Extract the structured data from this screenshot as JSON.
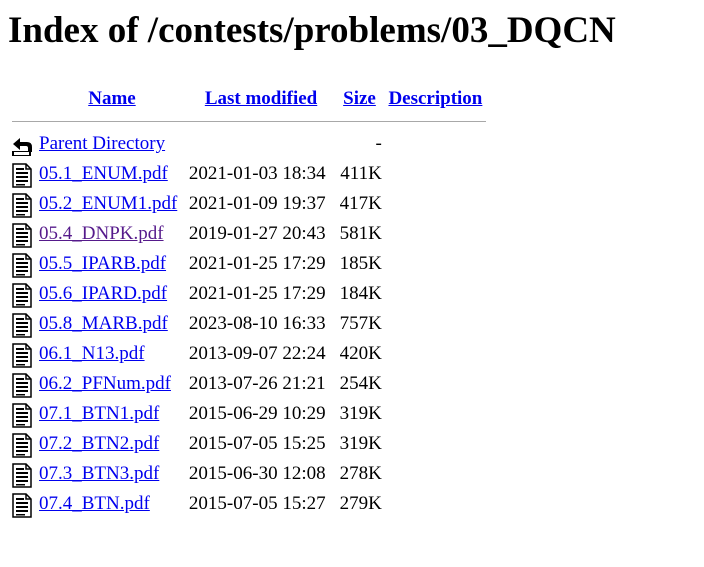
{
  "title": "Index of /contests/problems/03_DQCN",
  "columns": {
    "name": "Name",
    "last_modified": "Last modified",
    "size": "Size",
    "description": "Description"
  },
  "parent": {
    "label": "Parent Directory",
    "size": "-",
    "icon": "back-folder-icon"
  },
  "files": [
    {
      "name": "05.1_ENUM.pdf",
      "modified": "2021-01-03 18:34",
      "size": "411K",
      "visited": false
    },
    {
      "name": "05.2_ENUM1.pdf",
      "modified": "2021-01-09 19:37",
      "size": "417K",
      "visited": false
    },
    {
      "name": "05.4_DNPK.pdf",
      "modified": "2019-01-27 20:43",
      "size": "581K",
      "visited": true
    },
    {
      "name": "05.5_IPARB.pdf",
      "modified": "2021-01-25 17:29",
      "size": "185K",
      "visited": false
    },
    {
      "name": "05.6_IPARD.pdf",
      "modified": "2021-01-25 17:29",
      "size": "184K",
      "visited": false
    },
    {
      "name": "05.8_MARB.pdf",
      "modified": "2023-08-10 16:33",
      "size": "757K",
      "visited": false
    },
    {
      "name": "06.1_N13.pdf",
      "modified": "2013-09-07 22:24",
      "size": "420K",
      "visited": false
    },
    {
      "name": "06.2_PFNum.pdf",
      "modified": "2013-07-26 21:21",
      "size": "254K",
      "visited": false
    },
    {
      "name": "07.1_BTN1.pdf",
      "modified": "2015-06-29 10:29",
      "size": "319K",
      "visited": false
    },
    {
      "name": "07.2_BTN2.pdf",
      "modified": "2015-07-05 15:25",
      "size": "319K",
      "visited": false
    },
    {
      "name": "07.3_BTN3.pdf",
      "modified": "2015-06-30 12:08",
      "size": "278K",
      "visited": false
    },
    {
      "name": "07.4_BTN.pdf",
      "modified": "2015-07-05 15:27",
      "size": "279K",
      "visited": false
    }
  ],
  "colors": {
    "link": "#0000ee",
    "visited_link": "#551a8b",
    "rule": "#a8a8a8"
  }
}
